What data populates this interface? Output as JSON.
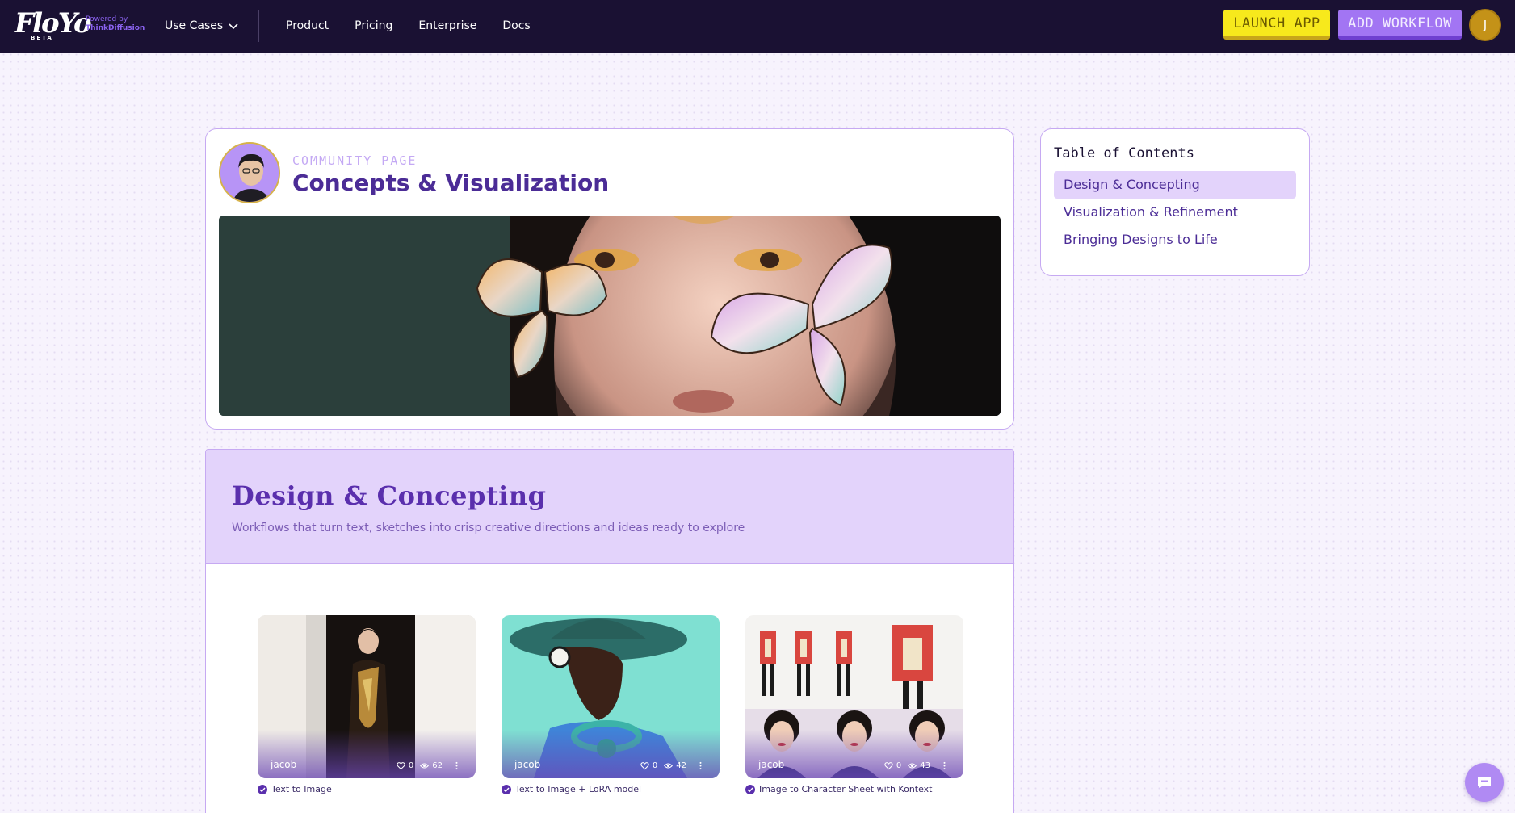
{
  "nav": {
    "logo_text": "FloYo",
    "logo_badge": "BETA",
    "powered_by": "Powered by",
    "powered_brand": "ThinkDiffusion",
    "use_cases": "Use Cases",
    "links": [
      "Product",
      "Pricing",
      "Enterprise",
      "Docs"
    ],
    "launch_button": "LAUNCH APP",
    "add_button": "ADD WORKFLOW",
    "avatar_initial": "J"
  },
  "hero": {
    "kicker": "COMMUNITY PAGE",
    "title": "Concepts & Visualization"
  },
  "toc": {
    "title": "Table of Contents",
    "items": [
      "Design & Concepting",
      "Visualization & Refinement",
      "Bringing Designs to Life"
    ],
    "active_index": 0
  },
  "section": {
    "title": "Design & Concepting",
    "description": "Workflows that turn text, sketches into crisp creative directions and ideas ready to explore",
    "cards": [
      {
        "user": "jacob",
        "likes": "0",
        "views": "62",
        "label": "Text to Image"
      },
      {
        "user": "jacob",
        "likes": "0",
        "views": "42",
        "label": "Text to Image + LoRA model"
      },
      {
        "user": "jacob",
        "likes": "0",
        "views": "43",
        "label": "Image to Character Sheet with Kontext"
      }
    ]
  },
  "colors": {
    "nav_bg": "#1a1133",
    "accent_purple": "#4b2c96",
    "launch_yellow": "#f7e91c",
    "add_purple": "#a275f3",
    "section_bg": "#e3d3fb"
  },
  "icons": [
    "chevron-down-icon",
    "heart-icon",
    "eye-icon",
    "more-vertical-icon",
    "verified-check-icon",
    "chat-icon"
  ]
}
